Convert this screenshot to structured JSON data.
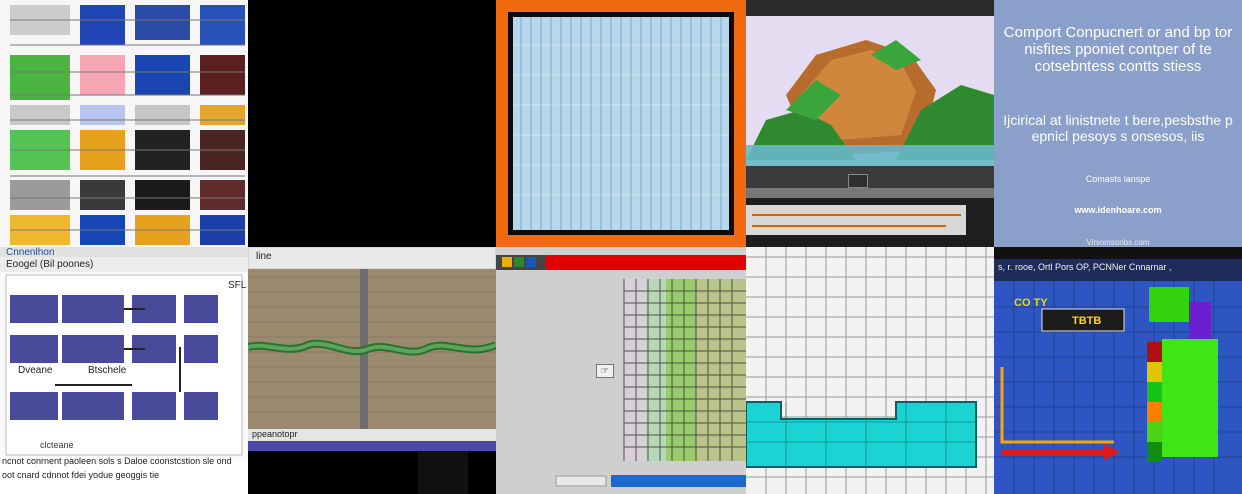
{
  "tile1": {
    "label": ""
  },
  "tile4": {
    "top_text": ""
  },
  "tile5": {
    "title": "Comport Conpucnert or and bp tor nisfites pponiet contper of te cotsebntess contts stiess",
    "subtitle": "Ijcirical at linistnete t bere,pesbsthe p epnicl pesoys s onsesos, iis",
    "small_text": "Comasts lanspe",
    "url": "www.idenhoare.com",
    "footer": "Viniomsonbs.com"
  },
  "tile6": {
    "top_title": "Cnnenlhon",
    "toolbar_text": "Eoogel  (Bil poones)",
    "right_label": "SFL",
    "label_a": "Dveane",
    "label_b": "Btschele",
    "bottom_line1": "clcteane",
    "bottom_line2": "ncnot conrnent paoleen sols s Daloe coonstcstion sle ond",
    "bottom_line3": "oot cnard cdnnot fdei yodue geoggis tie"
  },
  "tile7": {
    "toolbar": "line",
    "status": "ppeanotopr"
  },
  "tile10": {
    "top_row": "s, r. rooe, Ortl Pors OP, PCNNer Cnnarnar ,",
    "label_top": "CO TY",
    "label_middle": "TBTB"
  }
}
